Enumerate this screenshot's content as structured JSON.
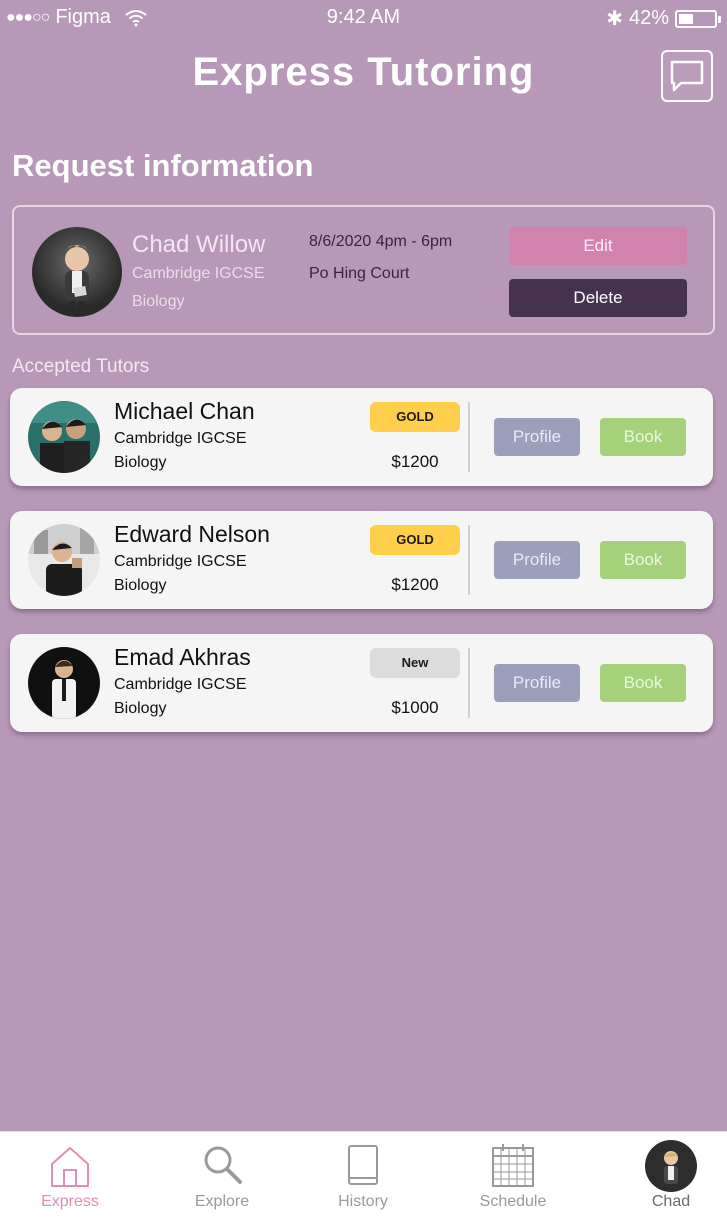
{
  "status_bar": {
    "carrier": "Figma",
    "signal": "●●●○○",
    "time": "9:42 AM",
    "bluetooth": "✱",
    "battery_percent": "42%",
    "battery_level": 0.42
  },
  "header": {
    "title": "Express Tutoring",
    "chat_icon": "chat-bubble-icon"
  },
  "request": {
    "section_title": "Request information",
    "student_name": "Chad Willow",
    "curriculum": "Cambridge IGCSE",
    "subject": "Biology",
    "datetime": "8/6/2020 4pm - 6pm",
    "location": "Po Hing Court",
    "edit_label": "Edit",
    "delete_label": "Delete"
  },
  "accepted": {
    "label": "Accepted Tutors",
    "tutors": [
      {
        "name": "Michael Chan",
        "curriculum": "Cambridge IGCSE",
        "subject": "Biology",
        "badge": "GOLD",
        "badge_color": "#ffce4a",
        "price": "$1200",
        "profile_label": "Profile",
        "book_label": "Book"
      },
      {
        "name": "Edward Nelson",
        "curriculum": "Cambridge IGCSE",
        "subject": "Biology",
        "badge": "GOLD",
        "badge_color": "#ffce4a",
        "price": "$1200",
        "profile_label": "Profile",
        "book_label": "Book"
      },
      {
        "name": "Emad Akhras",
        "curriculum": "Cambridge IGCSE",
        "subject": "Biology",
        "badge": "New",
        "badge_color": "#dcdcdc",
        "price": "$1000",
        "profile_label": "Profile",
        "book_label": "Book"
      }
    ]
  },
  "tab_bar": {
    "tabs": [
      {
        "label": "Express",
        "icon": "home-icon",
        "active": true
      },
      {
        "label": "Explore",
        "icon": "search-icon",
        "active": false
      },
      {
        "label": "History",
        "icon": "book-icon",
        "active": false
      },
      {
        "label": "Schedule",
        "icon": "calendar-icon",
        "active": false
      },
      {
        "label": "Chad",
        "icon": "avatar",
        "active": false
      }
    ]
  },
  "colors": {
    "background": "#b898b8",
    "edit": "#d183ae",
    "delete": "#453150",
    "profile": "#9b9fbb",
    "book": "#a6d17b",
    "active_tab": "#e58bb8"
  }
}
